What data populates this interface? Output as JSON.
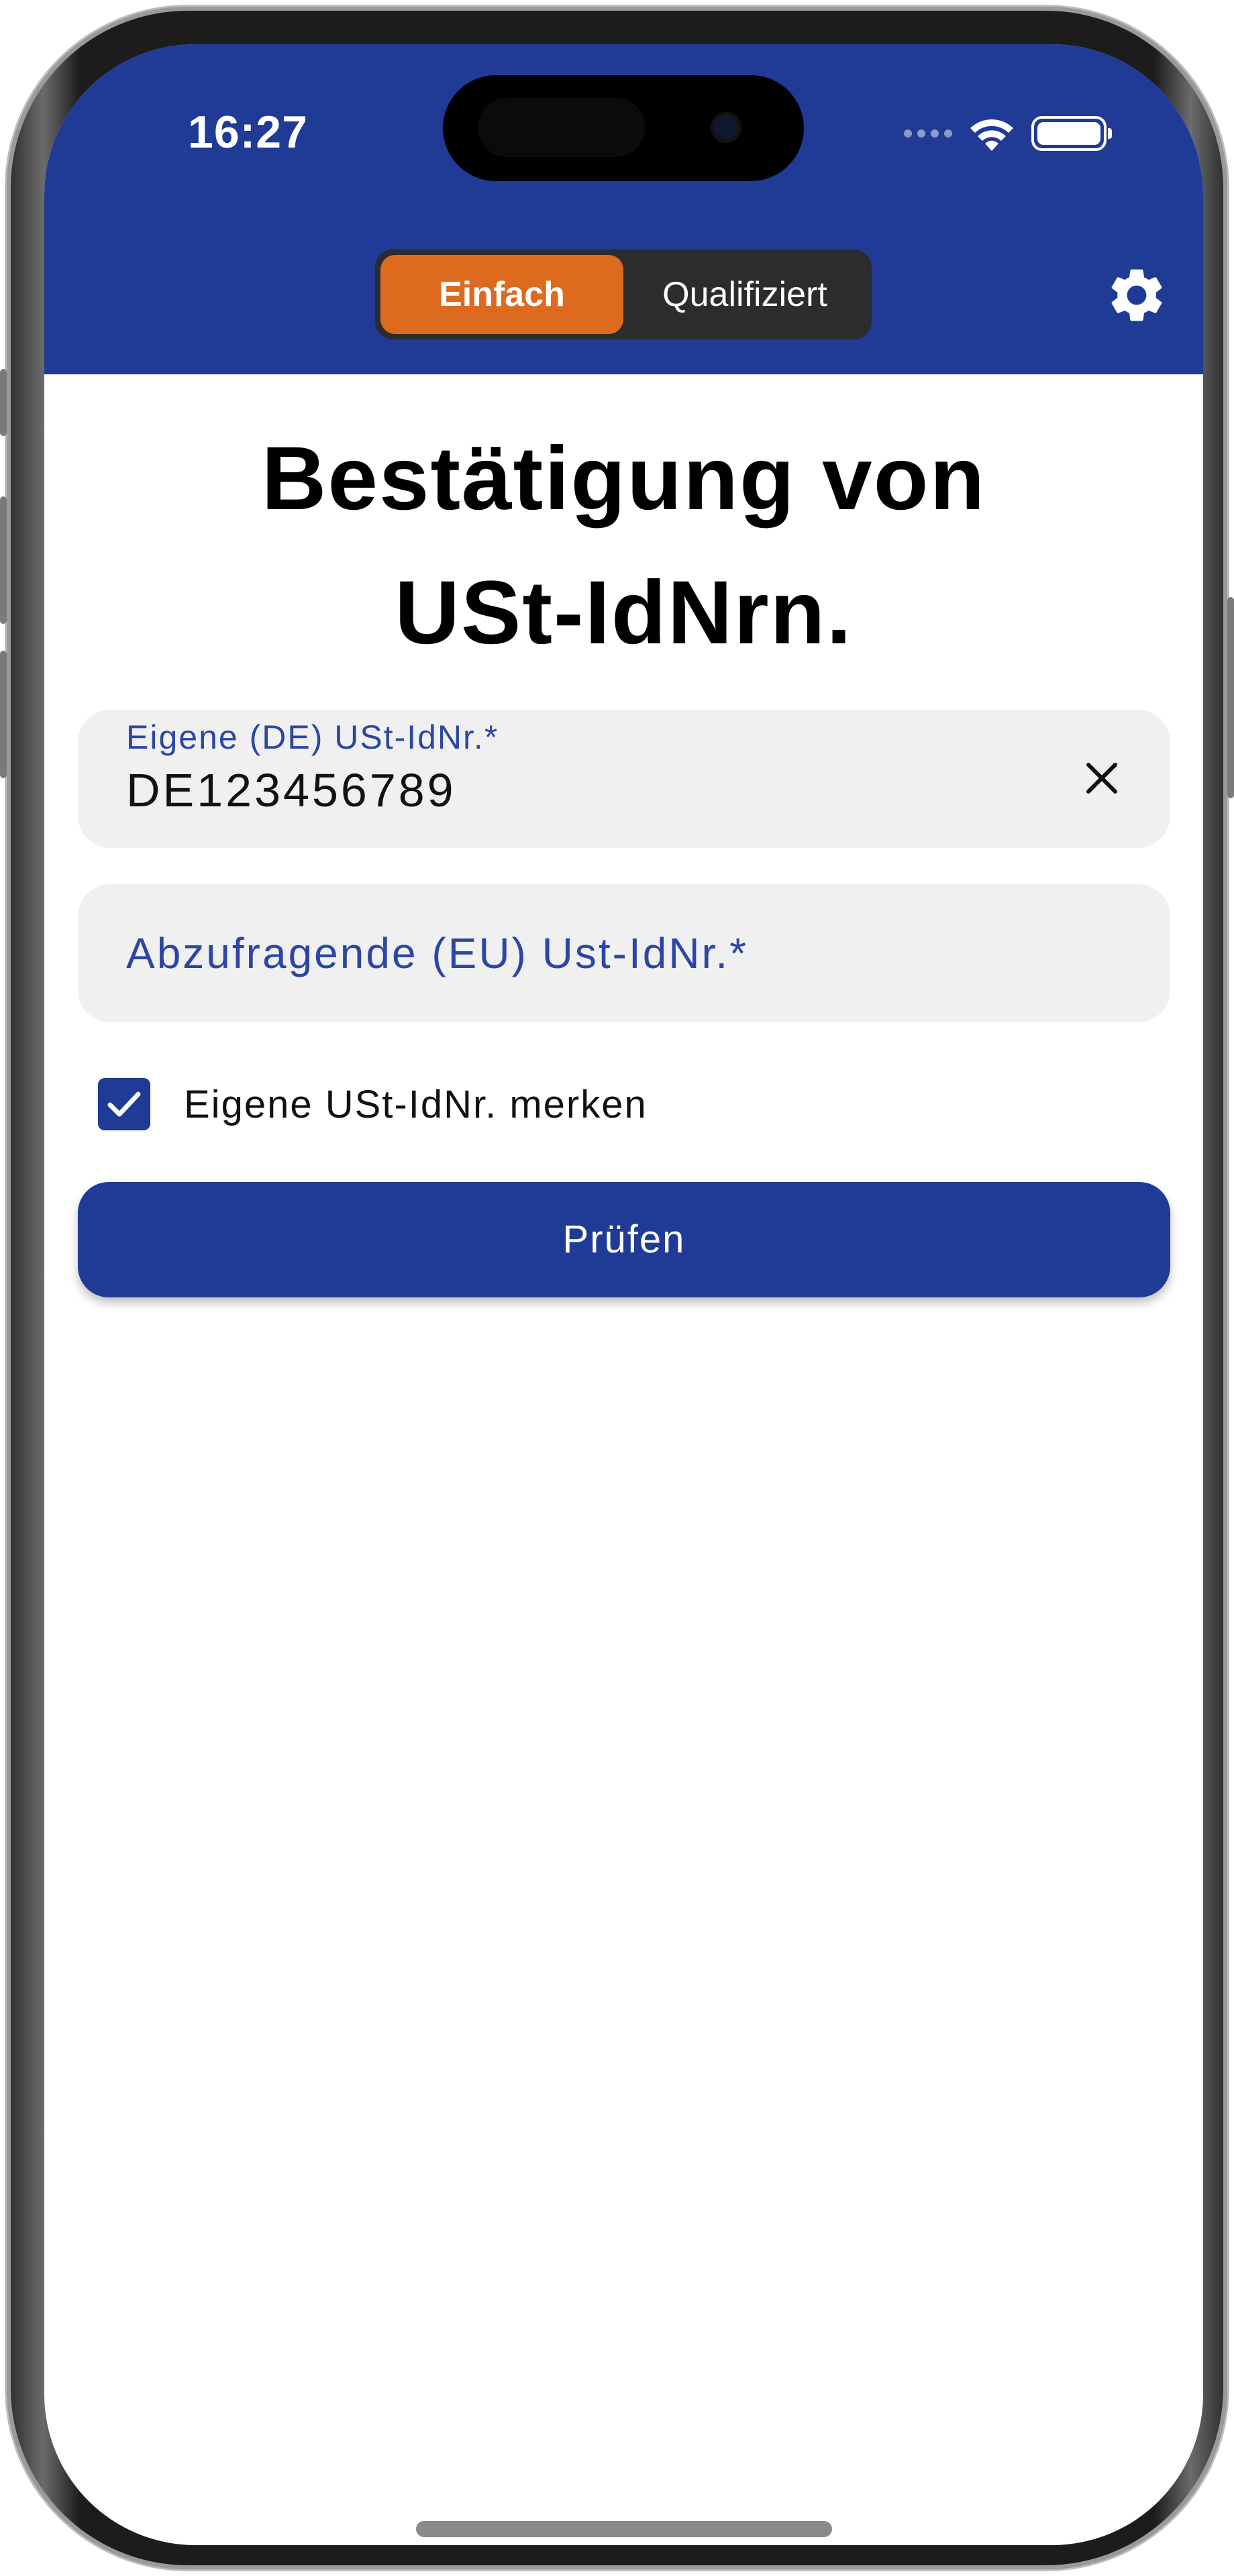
{
  "status_bar": {
    "time": "16:27"
  },
  "header": {
    "segments": [
      {
        "label": "Einfach",
        "selected": true
      },
      {
        "label": "Qualifiziert",
        "selected": false
      }
    ],
    "settings_icon": "gear-icon"
  },
  "main": {
    "title_line1": "Bestätigung von",
    "title_line2": "USt-IdNrn.",
    "own_vat_field": {
      "label": "Eigene (DE) USt-IdNr.*",
      "value": "DE123456789",
      "clear_icon": "close-icon"
    },
    "query_vat_field": {
      "placeholder": "Abzufragende (EU) Ust-IdNr.*",
      "value": ""
    },
    "remember_checkbox": {
      "label": "Eigene USt-IdNr. merken",
      "checked": true
    },
    "submit_button": {
      "label": "Prüfen"
    }
  },
  "colors": {
    "header_blue": "#1f3b96",
    "accent_orange": "#dd6a1f",
    "label_blue": "#2c46a5",
    "field_bg": "#f0f0f0"
  }
}
